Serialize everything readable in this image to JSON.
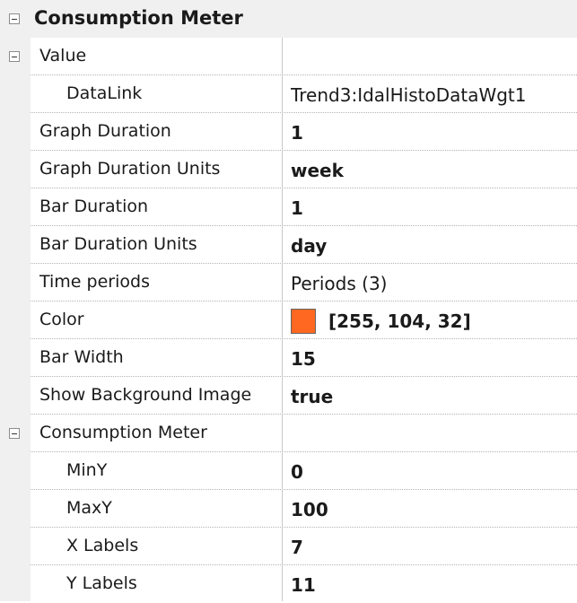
{
  "category": {
    "title": "Consumption Meter"
  },
  "rows": [
    {
      "label": "Value",
      "value": ""
    },
    {
      "label": "DataLink",
      "value": "Trend3:IdalHistoDataWgt1"
    },
    {
      "label": "Graph Duration",
      "value": "1"
    },
    {
      "label": "Graph Duration Units",
      "value": "week"
    },
    {
      "label": "Bar Duration",
      "value": "1"
    },
    {
      "label": "Bar Duration Units",
      "value": "day"
    },
    {
      "label": "Time periods",
      "value": "Periods (3)"
    },
    {
      "label": "Color",
      "value": "[255, 104, 32]",
      "swatch_color": "#ff6820"
    },
    {
      "label": "Bar Width",
      "value": "15"
    },
    {
      "label": "Show Background Image",
      "value": "true"
    },
    {
      "label": "Consumption Meter",
      "value": ""
    },
    {
      "label": "MinY",
      "value": "0"
    },
    {
      "label": "MaxY",
      "value": "100"
    },
    {
      "label": "X Labels",
      "value": "7"
    },
    {
      "label": "Y Labels",
      "value": "11"
    }
  ]
}
